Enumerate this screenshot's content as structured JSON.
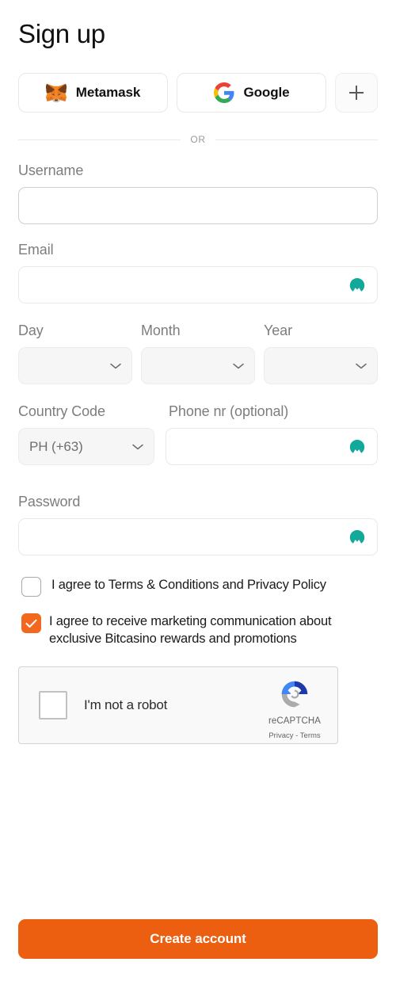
{
  "header": {
    "title": "Sign up"
  },
  "social": {
    "metamask": {
      "label": "Metamask",
      "icon": "metamask-fox-icon"
    },
    "google": {
      "label": "Google",
      "icon": "google-g-icon"
    },
    "more": {
      "label": "+",
      "icon": "plus-icon"
    }
  },
  "divider": {
    "text": "OR"
  },
  "form": {
    "username": {
      "label": "Username",
      "value": "",
      "placeholder": ""
    },
    "email": {
      "label": "Email",
      "value": "",
      "placeholder": "",
      "icon": "nordpass-icon"
    },
    "birthdate": {
      "day": {
        "label": "Day",
        "value": ""
      },
      "month": {
        "label": "Month",
        "value": ""
      },
      "year": {
        "label": "Year",
        "value": ""
      }
    },
    "country_code": {
      "label": "Country Code",
      "value": "PH (+63)"
    },
    "phone": {
      "label": "Phone nr (optional)",
      "value": "",
      "placeholder": "",
      "icon": "nordpass-icon"
    },
    "password": {
      "label": "Password",
      "value": "",
      "placeholder": "",
      "icon": "nordpass-icon"
    }
  },
  "consents": {
    "terms": {
      "text": "I agree to Terms & Conditions and Privacy Policy",
      "checked": false
    },
    "marketing": {
      "text": "I agree to receive marketing communication about exclusive Bitcasino rewards and promotions",
      "checked": true
    }
  },
  "recaptcha": {
    "label": "I'm not a robot",
    "brand": "reCAPTCHA",
    "privacy": "Privacy",
    "separator": "-",
    "terms": "Terms",
    "checked": false
  },
  "submit": {
    "label": "Create account"
  },
  "colors": {
    "accent_orange": "#ec5f10",
    "checkbox_orange": "#f2681e",
    "nordpass_teal": "#14a89a",
    "label_gray": "#7d7d7d",
    "border_gray": "#e9e9e9"
  }
}
